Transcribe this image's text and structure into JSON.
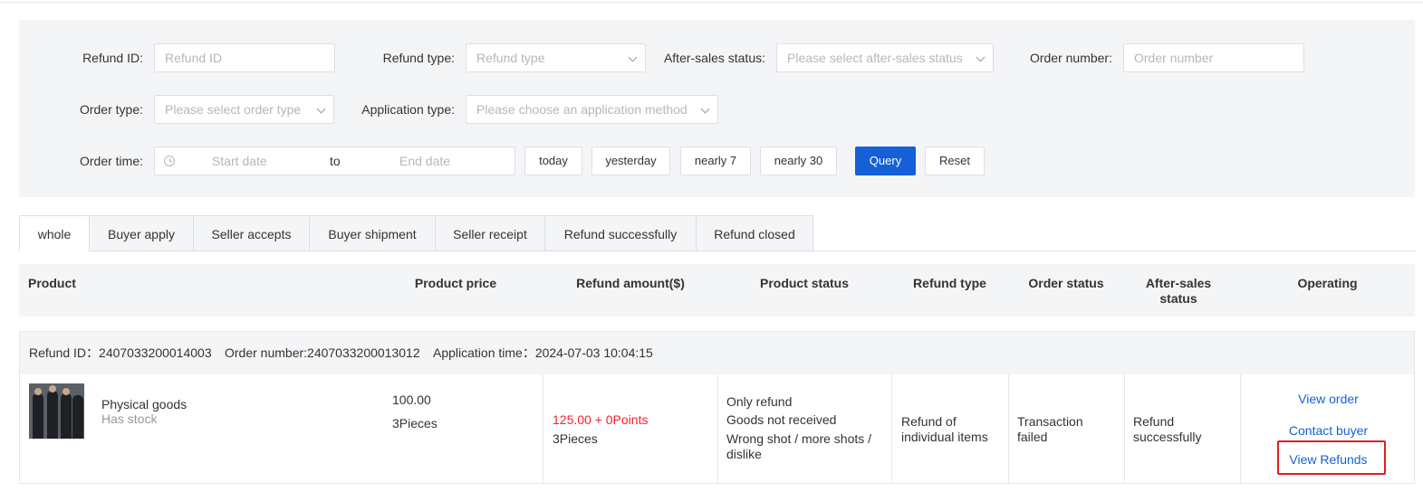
{
  "filters": {
    "refund_id": {
      "label": "Refund ID:",
      "placeholder": "Refund ID"
    },
    "refund_type": {
      "label": "Refund type:",
      "placeholder": "Refund type"
    },
    "after_sales_status": {
      "label": "After-sales status:",
      "placeholder": "Please select after-sales status"
    },
    "order_number": {
      "label": "Order number:",
      "placeholder": "Order number"
    },
    "order_type": {
      "label": "Order type:",
      "placeholder": "Please select order type"
    },
    "application_type": {
      "label": "Application type:",
      "placeholder": "Please choose an application method"
    },
    "order_time": {
      "label": "Order time:",
      "start_placeholder": "Start date",
      "separator": "to",
      "end_placeholder": "End date"
    },
    "quick_ranges": [
      "today",
      "yesterday",
      "nearly 7",
      "nearly 30"
    ],
    "query_label": "Query",
    "reset_label": "Reset"
  },
  "tabs": [
    "whole",
    "Buyer apply",
    "Seller accepts",
    "Buyer shipment",
    "Seller receipt",
    "Refund successfully",
    "Refund closed"
  ],
  "table": {
    "headers": {
      "product": "Product",
      "product_price": "Product price",
      "refund_amount": "Refund amount($)",
      "product_status": "Product status",
      "refund_type": "Refund type",
      "order_status": "Order status",
      "after_sales_status_line1": "After-sales",
      "after_sales_status_line2": "status",
      "operating": "Operating"
    },
    "order": {
      "refund_id_text": "Refund ID：2407033200014003",
      "order_number_text": "Order number:2407033200013012",
      "application_time_text": "Application time：2024-07-03 10:04:15",
      "product_name": "Physical goods",
      "product_stock": "Has stock",
      "price": "100.00",
      "quantity": "3Pieces",
      "refund_amount": "125.00 + 0Points",
      "refund_quantity": "3Pieces",
      "product_status_lines": [
        "Only refund",
        "Goods not received",
        "Wrong shot / more shots / dislike"
      ],
      "refund_type": "Refund of individual items",
      "order_status": "Transaction failed",
      "after_sales_status": "Refund successfully",
      "actions": {
        "view_order": "View order",
        "contact_buyer": "Contact buyer",
        "view_refunds": "View Refunds"
      }
    }
  },
  "colors": {
    "primary": "#1660d7",
    "danger": "#e02020",
    "price_red": "#f5222d",
    "panel_bg": "#f4f5f7"
  }
}
